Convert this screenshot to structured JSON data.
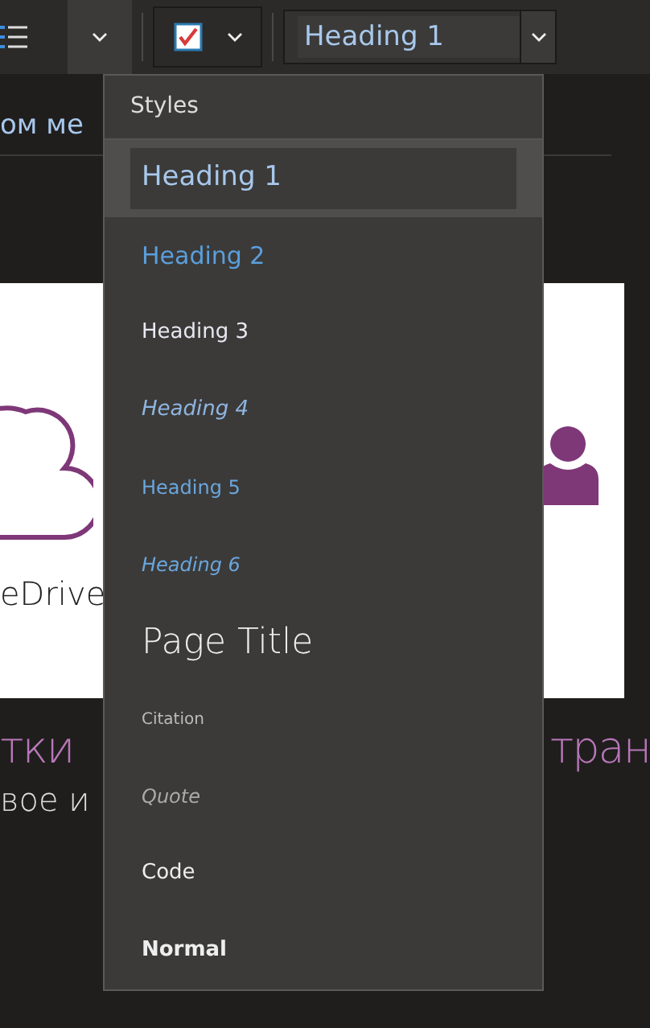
{
  "toolbar": {
    "style_box": {
      "value": "Heading 1"
    },
    "checkbox": {
      "checked": true
    }
  },
  "background": {
    "top_text": "ом ме",
    "card_caption": "eDrive",
    "pink_left": "тки",
    "pink_right": "тран",
    "subtitle": "вое и"
  },
  "styles_menu": {
    "title": "Styles",
    "items": [
      {
        "label": "Heading 1",
        "kind": "heading1",
        "selected": true
      },
      {
        "label": "Heading 2",
        "kind": "heading2",
        "selected": false
      },
      {
        "label": "Heading 3",
        "kind": "heading3",
        "selected": false
      },
      {
        "label": "Heading 4",
        "kind": "heading4",
        "selected": false
      },
      {
        "label": "Heading 5",
        "kind": "heading5",
        "selected": false
      },
      {
        "label": "Heading 6",
        "kind": "heading6",
        "selected": false
      },
      {
        "label": "Page Title",
        "kind": "title",
        "selected": false
      },
      {
        "label": "Citation",
        "kind": "citation",
        "selected": false
      },
      {
        "label": "Quote",
        "kind": "quote",
        "selected": false
      },
      {
        "label": "Code",
        "kind": "code",
        "selected": false
      },
      {
        "label": "Normal",
        "kind": "normal",
        "selected": false
      }
    ]
  }
}
